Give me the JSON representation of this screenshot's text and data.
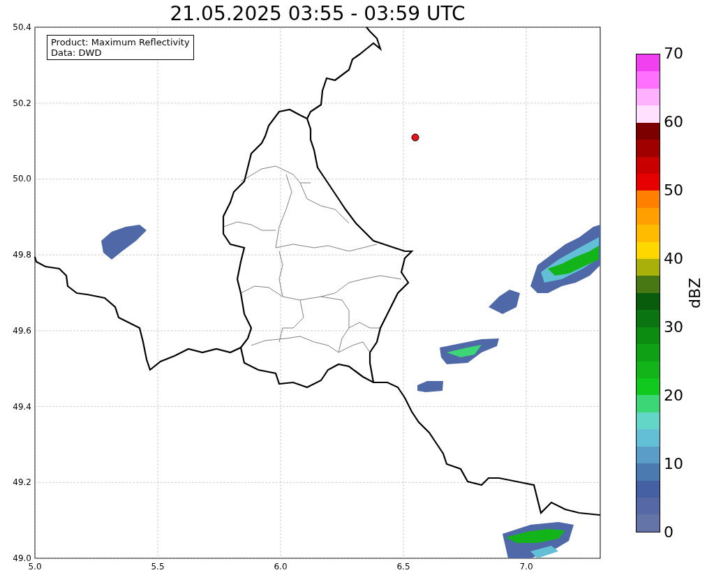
{
  "title": "21.05.2025 03:55 - 03:59 UTC",
  "info_box": {
    "lines": [
      "Product: Maximum Reflectivity",
      "Data: DWD"
    ]
  },
  "x_ticks": [
    "5.0",
    "5.5",
    "6.0",
    "6.5",
    "7.0"
  ],
  "y_ticks": [
    "50.4",
    "50.2",
    "50.0",
    "49.8",
    "49.6",
    "49.4",
    "49.2",
    "49.0"
  ],
  "colorbar": {
    "label": "dBZ",
    "ticks": [
      "70",
      "60",
      "50",
      "40",
      "30",
      "20",
      "10",
      "0"
    ],
    "segments": [
      {
        "color": "#f040f0"
      },
      {
        "color": "#ff70ff"
      },
      {
        "color": "#ffb0ff"
      },
      {
        "color": "#ffe0ff"
      },
      {
        "color": "#7d0000"
      },
      {
        "color": "#a00000"
      },
      {
        "color": "#c80000"
      },
      {
        "color": "#e60000"
      },
      {
        "color": "#ff8000"
      },
      {
        "color": "#ffa000"
      },
      {
        "color": "#ffbb00"
      },
      {
        "color": "#ffd700"
      },
      {
        "color": "#aab00a"
      },
      {
        "color": "#487814"
      },
      {
        "color": "#085c0c"
      },
      {
        "color": "#0a7410"
      },
      {
        "color": "#0d8c12"
      },
      {
        "color": "#0fa014"
      },
      {
        "color": "#12b41a"
      },
      {
        "color": "#10c81e"
      },
      {
        "color": "#3cd676"
      },
      {
        "color": "#64d6c8"
      },
      {
        "color": "#62bfd6"
      },
      {
        "color": "#5a9dc8"
      },
      {
        "color": "#4a7ab0"
      },
      {
        "color": "#4560a3"
      },
      {
        "color": "#5668a5"
      },
      {
        "color": "#6474a8"
      }
    ]
  }
}
